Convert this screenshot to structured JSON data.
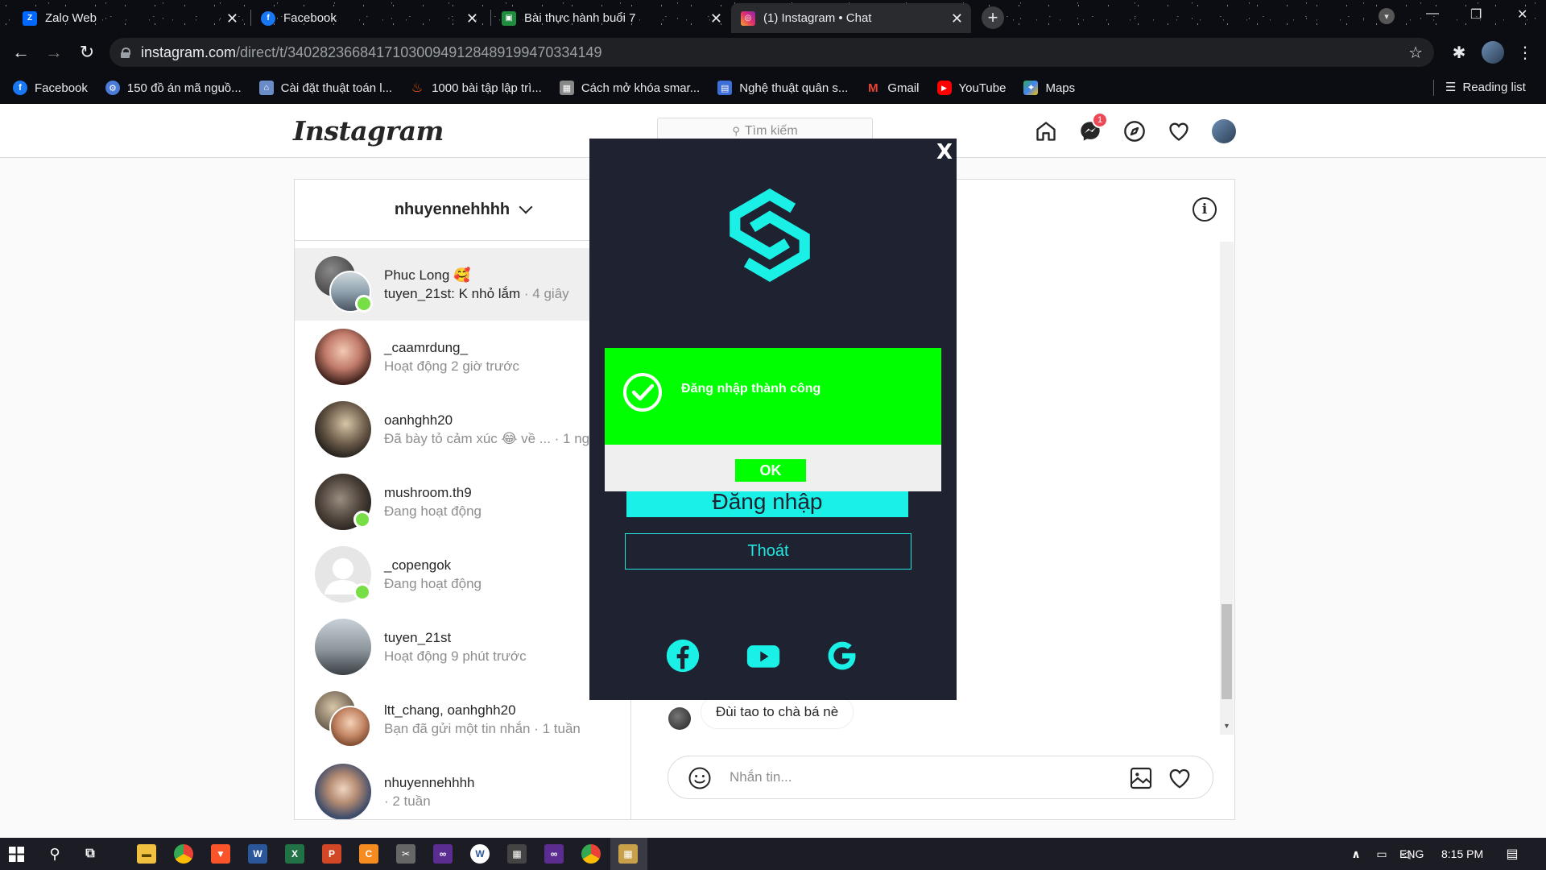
{
  "browser": {
    "tabs": [
      {
        "title": "Zalo Web",
        "icon": "zalo-icon",
        "color": "#0068ff"
      },
      {
        "title": "Facebook",
        "icon": "facebook-icon",
        "color": "#1877f2"
      },
      {
        "title": "Bài thực hành buổi 7",
        "icon": "classroom-icon",
        "color": "#1e8e3e"
      },
      {
        "title": "(1) Instagram • Chat",
        "icon": "instagram-icon",
        "color": "#e1306c"
      }
    ],
    "url_host": "instagram.com",
    "url_path": "/direct/t/340282366841710300949128489199470334149",
    "bookmarks": [
      {
        "label": "Facebook",
        "icon": "facebook-icon",
        "color": "#1877f2"
      },
      {
        "label": "150 đồ án mã nguồ...",
        "icon": "gear-icon",
        "color": "#4a7bd6"
      },
      {
        "label": "Cài đặt thuật toán l...",
        "icon": "site-icon",
        "color": "#6a8cc7"
      },
      {
        "label": "1000 bài tập lập trì...",
        "icon": "fire-icon",
        "color": "#f25c05"
      },
      {
        "label": "Cách mở khóa smar...",
        "icon": "site-icon",
        "color": "#888888"
      },
      {
        "label": "Nghệ thuật quân s...",
        "icon": "site-icon",
        "color": "#3b6ed6"
      },
      {
        "label": "Gmail",
        "icon": "gmail-icon",
        "color": "#ea4335"
      },
      {
        "label": "YouTube",
        "icon": "youtube-icon",
        "color": "#ff0000"
      },
      {
        "label": "Maps",
        "icon": "maps-icon",
        "color": "#34a853"
      }
    ],
    "reading_list": "Reading list"
  },
  "instagram": {
    "logo": "Instagram",
    "search_placeholder": "Tìm kiếm",
    "messenger_badge": "1",
    "dm_username": "nhuyennehhhh",
    "conversations": [
      {
        "name": "Phuc Long 🥰",
        "sender": "tuyen_21st: K nhỏ lắm",
        "time": " · 4 giây",
        "online": true,
        "selected": true
      },
      {
        "name": "_caamrdung_",
        "sub": "Hoạt động 2 giờ trước",
        "online": false
      },
      {
        "name": "oanhghh20",
        "sub": "Đã bày tỏ cảm xúc 😂 về ... · 1 ng",
        "online": false
      },
      {
        "name": "mushroom.th9",
        "sub": "Đang hoạt động",
        "online": true
      },
      {
        "name": "_copengok",
        "sub": "Đang hoạt động",
        "online": true
      },
      {
        "name": "tuyen_21st",
        "sub": "Hoạt động 9 phút trước",
        "online": false
      },
      {
        "name": "ltt_chang, oanhghh20",
        "sub": "Bạn đã gửi một tin nhắn · 1 tuần",
        "online": false
      },
      {
        "name": "nhuyennehhhh",
        "sub": " · 2 tuần",
        "online": false
      }
    ],
    "last_message": "Đùi tao to chà bá nè",
    "message_placeholder": "Nhắn tin..."
  },
  "modal": {
    "close_label": "X",
    "login_label": "Đăng nhập",
    "exit_label": "Thoát",
    "alert_message": "Đăng nhập thành công",
    "ok_label": "OK",
    "colors": {
      "bg": "#1f2230",
      "accent": "#1af0e6",
      "success": "#00ff00"
    }
  },
  "taskbar": {
    "lang": "ENG",
    "time": "8:15 PM"
  }
}
